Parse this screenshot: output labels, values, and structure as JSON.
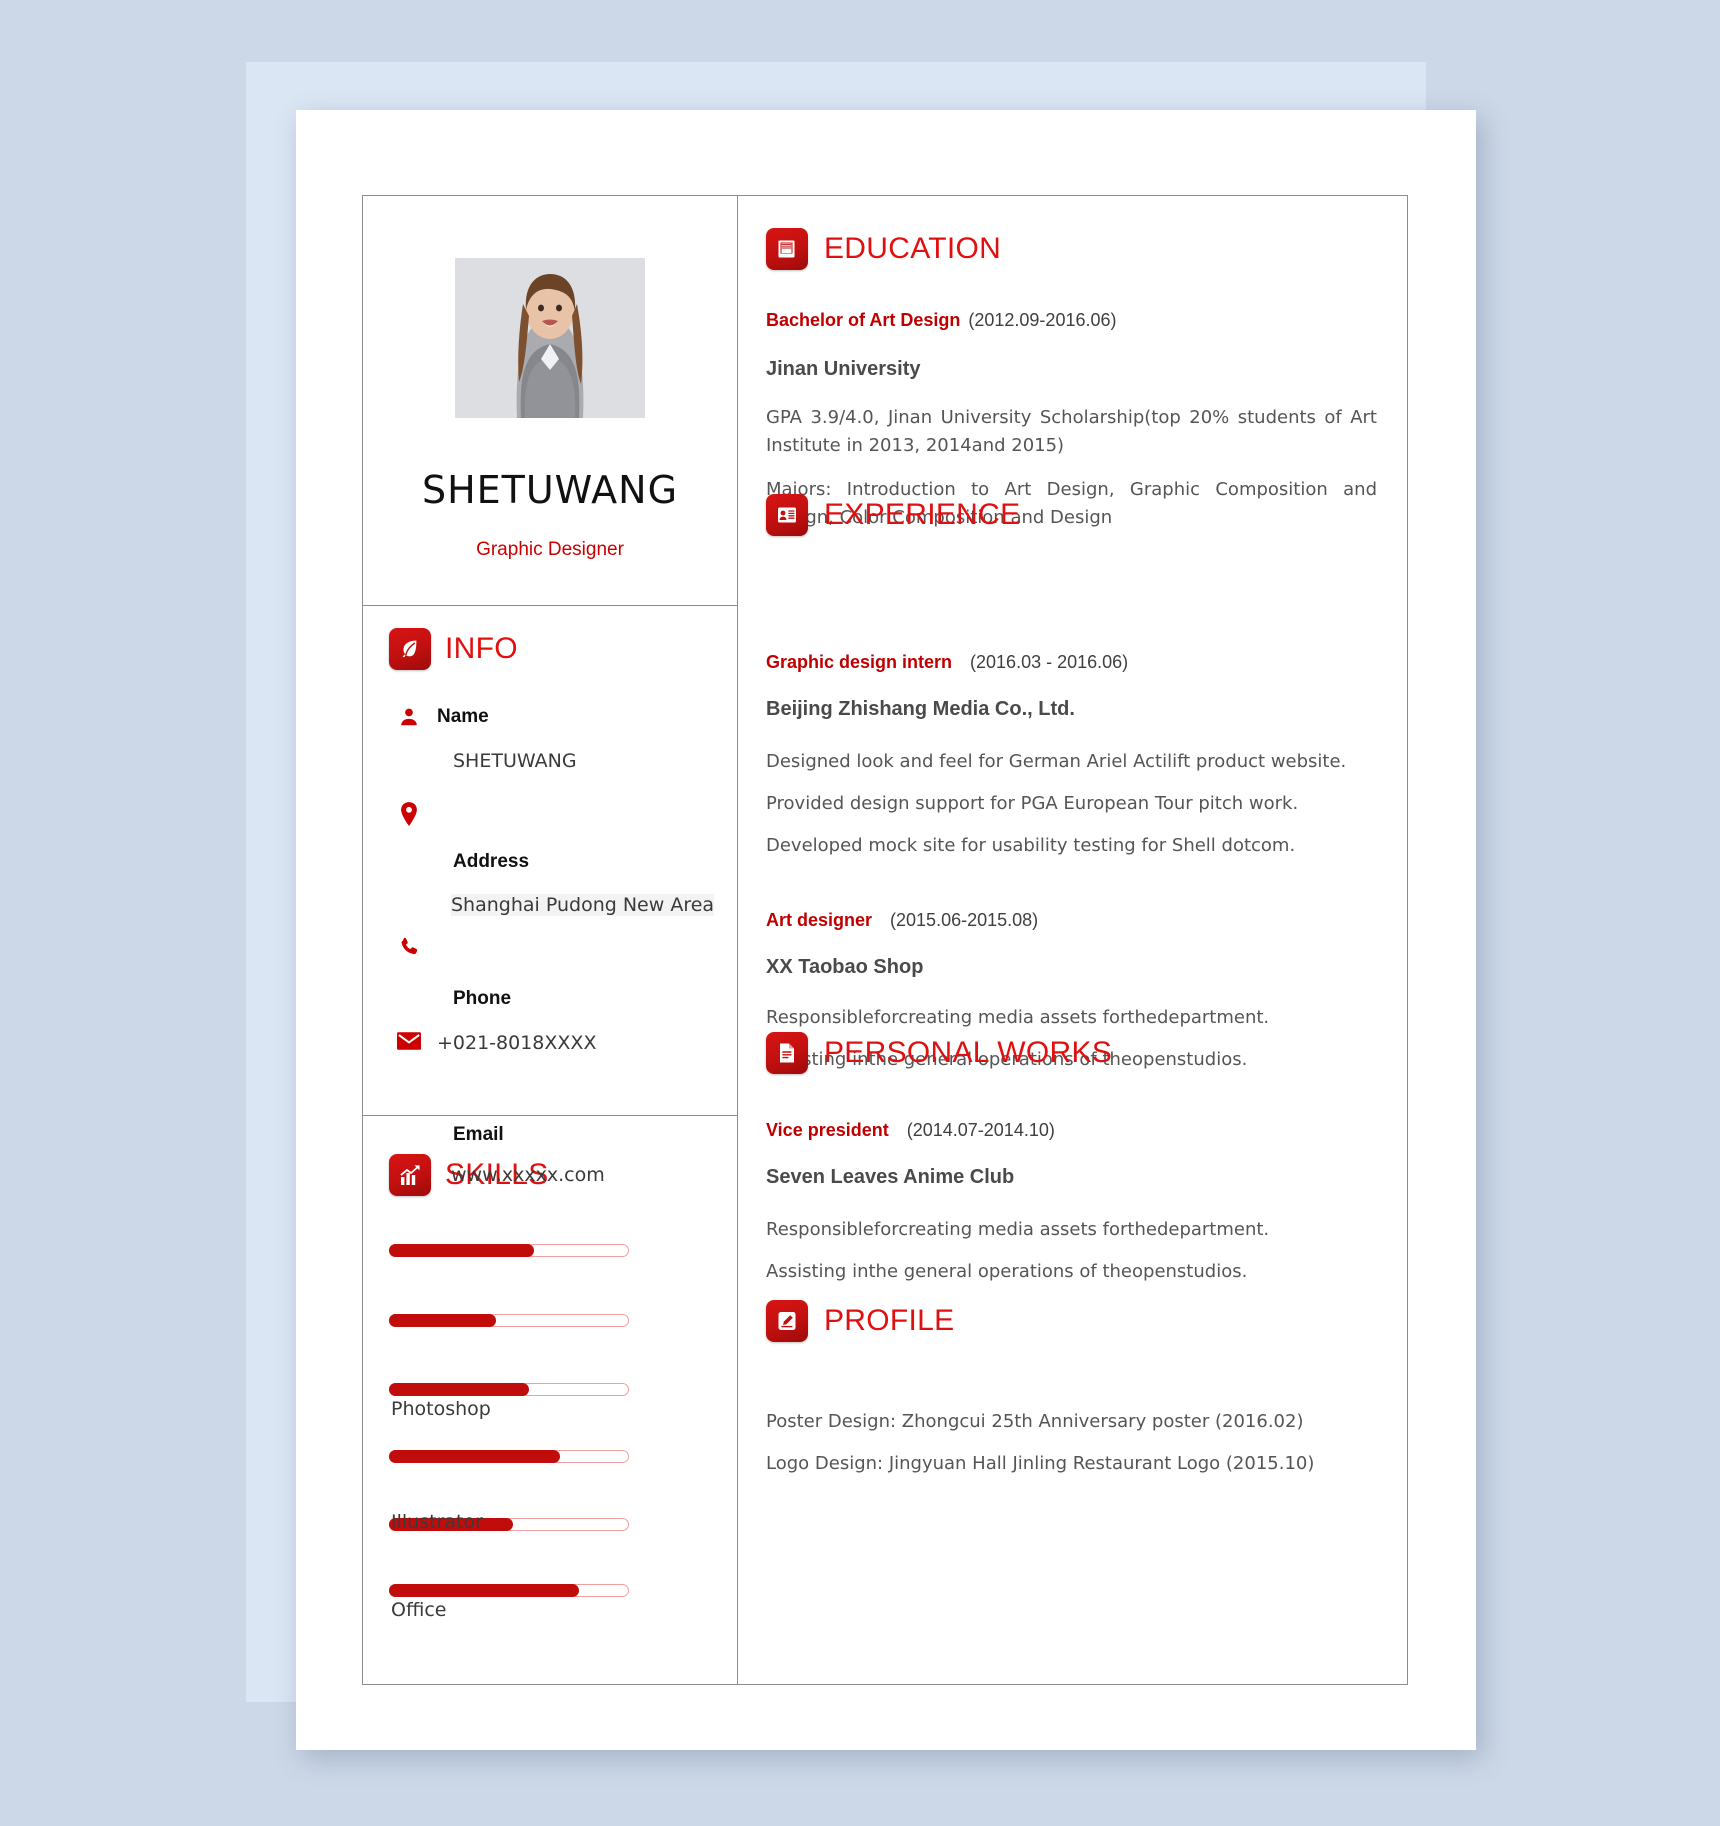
{
  "theme": {
    "accent": "#cc0000",
    "accent_bright": "#e01010",
    "text": "#555555",
    "heading": "#4a4a4a"
  },
  "profile": {
    "name": "SHETUWANG",
    "role": "Graphic Designer",
    "photo_alt": "portrait-photo"
  },
  "info": {
    "heading": "INFO",
    "icon": "leaf-icon",
    "rows": [
      {
        "icon": "person-icon",
        "label": "Name",
        "value": "SHETUWANG",
        "highlight": false
      },
      {
        "icon": "location-pin-icon",
        "label": "Address",
        "value": "Shanghai Pudong New Area",
        "highlight": true
      },
      {
        "icon": "phone-icon",
        "label": "Phone",
        "value": "+021-8018XXXX",
        "highlight": false
      },
      {
        "icon": "envelope-icon",
        "label": "Email",
        "value": "www.xxxxx.com",
        "highlight": false
      }
    ]
  },
  "skills": {
    "heading": "SKILLS",
    "icon": "chart-growth-icon",
    "items": [
      {
        "label": "",
        "percent": 61
      },
      {
        "label": "",
        "percent": 45
      },
      {
        "label": "Photoshop",
        "percent": 59
      },
      {
        "label": "",
        "percent": 72
      },
      {
        "label": "Illustrator",
        "percent": 52
      },
      {
        "label": "Office",
        "percent": 80
      }
    ]
  },
  "sections": {
    "education": {
      "heading": "EDUCATION",
      "icon": "book-icon",
      "degree": "Bachelor of Art Design",
      "degree_date": "(2012.09-2016.06)",
      "school": "Jinan University",
      "paragraphs": [
        "GPA 3.9/4.0, Jinan University Scholarship(top 20% students of Art Institute in 2013, 2014and 2015)",
        "Majors: Introduction to Art Design, Graphic Composition and Design, Color Composition and Design"
      ]
    },
    "experience": {
      "heading": "EXPERIENCE",
      "icon": "id-card-icon",
      "entries": [
        {
          "role": "Graphic design intern",
          "date": "(2016.03 - 2016.06)",
          "org": "Beijing Zhishang Media Co., Ltd.",
          "bullets": [
            "Designed look and feel for German Ariel Actilift product website.",
            "Provided design support for PGA European Tour pitch work.",
            "Developed mock site for usability testing for Shell dotcom."
          ]
        },
        {
          "role": "Art designer",
          "date": "(2015.06-2015.08)",
          "org": "XX Taobao Shop",
          "bullets": [
            "Responsibleforcreating media assets forthedepartment.",
            "Assisting inthe general operations of theopenstudios."
          ]
        }
      ]
    },
    "personal_works": {
      "heading": "PERSONAL WORKS",
      "icon": "document-icon",
      "entries": [
        {
          "role": "Vice president",
          "date": "(2014.07-2014.10)",
          "org": "Seven Leaves Anime Club",
          "bullets": [
            "Responsibleforcreating media assets forthedepartment.",
            "Assisting inthe general operations of theopenstudios."
          ]
        }
      ]
    },
    "profile_sec": {
      "heading": "PROFILE",
      "icon": "edit-document-icon",
      "lines": [
        "Poster Design: Zhongcui 25th Anniversary poster (2016.02)",
        "Logo Design: Jingyuan Hall Jinling Restaurant Logo (2015.10)"
      ]
    }
  }
}
